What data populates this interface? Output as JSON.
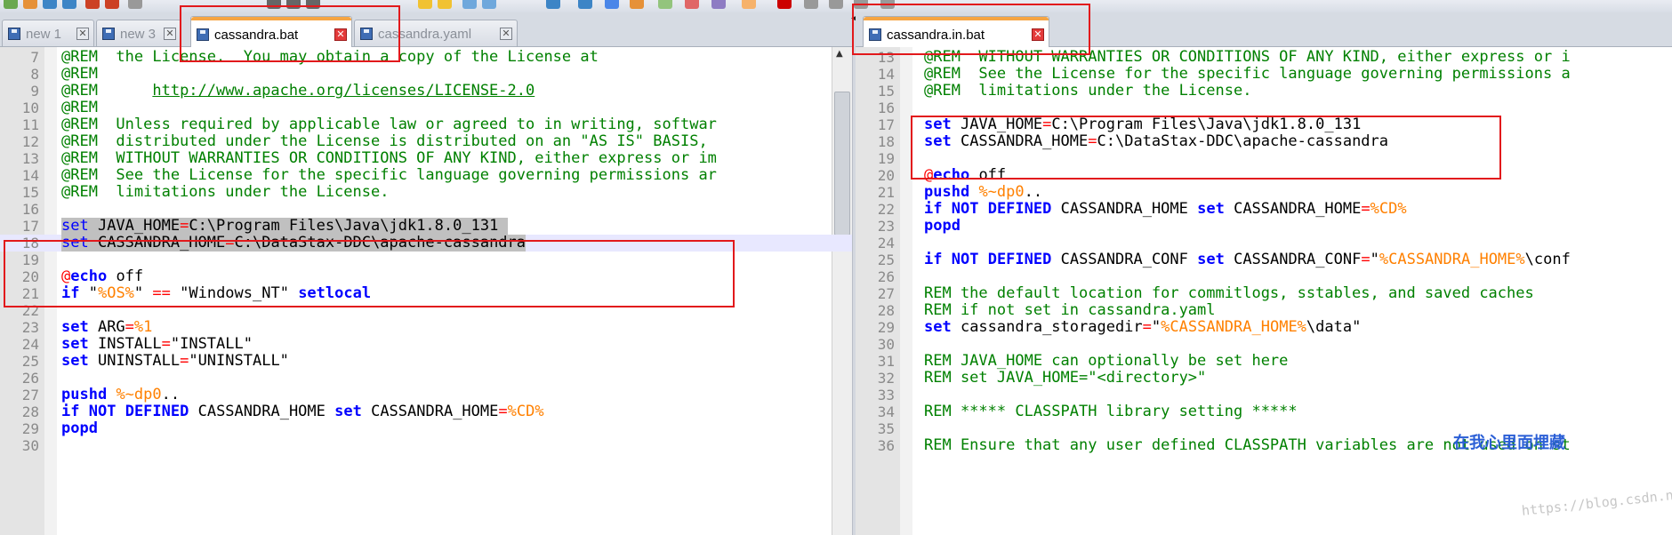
{
  "left_tabs": [
    {
      "label": "new 1",
      "active": false
    },
    {
      "label": "new 3",
      "active": false
    },
    {
      "label": "cassandra.bat",
      "active": true
    },
    {
      "label": "cassandra.yaml",
      "active": false
    }
  ],
  "right_tabs": [
    {
      "label": "cassandra.in.bat",
      "active": true
    }
  ],
  "left_lines": [
    {
      "n": "7",
      "parts": [
        [
          "rem",
          "@REM  the License.  You may obtain a copy of the License at"
        ]
      ]
    },
    {
      "n": "8",
      "parts": [
        [
          "rem",
          "@REM"
        ]
      ]
    },
    {
      "n": "9",
      "parts": [
        [
          "rem",
          "@REM      "
        ],
        [
          "link",
          "http://www.apache.org/licenses/LICENSE-2.0"
        ]
      ]
    },
    {
      "n": "10",
      "parts": [
        [
          "rem",
          "@REM"
        ]
      ]
    },
    {
      "n": "11",
      "parts": [
        [
          "rem",
          "@REM  Unless required by applicable law or agreed to in writing, softwar"
        ]
      ]
    },
    {
      "n": "12",
      "parts": [
        [
          "rem",
          "@REM  distributed under the License is distributed on an \"AS IS\" BASIS,"
        ]
      ]
    },
    {
      "n": "13",
      "parts": [
        [
          "rem",
          "@REM  WITHOUT WARRANTIES OR CONDITIONS OF ANY KIND, either express or im"
        ]
      ]
    },
    {
      "n": "14",
      "parts": [
        [
          "rem",
          "@REM  See the License for the specific language governing permissions ar"
        ]
      ]
    },
    {
      "n": "15",
      "parts": [
        [
          "rem",
          "@REM  limitations under the License."
        ]
      ]
    },
    {
      "n": "16",
      "parts": []
    },
    {
      "n": "17",
      "sel": true,
      "parts": [
        [
          "kwn",
          "set"
        ],
        [
          "txt",
          " JAVA_HOME"
        ],
        [
          "op",
          "="
        ],
        [
          "txt",
          "C:\\Program Files\\Java\\jdk1.8.0_131 "
        ]
      ]
    },
    {
      "n": "18",
      "sel": true,
      "current": true,
      "parts": [
        [
          "kwn",
          "set"
        ],
        [
          "txt",
          " CASSANDRA_HOME"
        ],
        [
          "op",
          "="
        ],
        [
          "txt",
          "C:\\DataStax-DDC\\apache-cassandra"
        ]
      ]
    },
    {
      "n": "19",
      "parts": []
    },
    {
      "n": "20",
      "parts": [
        [
          "op",
          "@"
        ],
        [
          "kw",
          "echo"
        ],
        [
          "txt",
          " off"
        ]
      ]
    },
    {
      "n": "21",
      "parts": [
        [
          "kw",
          "if"
        ],
        [
          "txt",
          " \""
        ],
        [
          "var",
          "%OS%"
        ],
        [
          "txt",
          "\" "
        ],
        [
          "op",
          "=="
        ],
        [
          "txt",
          " \"Windows_NT\" "
        ],
        [
          "kw",
          "setlocal"
        ]
      ]
    },
    {
      "n": "22",
      "parts": []
    },
    {
      "n": "23",
      "parts": [
        [
          "kw",
          "set"
        ],
        [
          "txt",
          " ARG"
        ],
        [
          "op",
          "="
        ],
        [
          "var",
          "%1"
        ]
      ]
    },
    {
      "n": "24",
      "parts": [
        [
          "kw",
          "set"
        ],
        [
          "txt",
          " INSTALL"
        ],
        [
          "op",
          "="
        ],
        [
          "txt",
          "\"INSTALL\""
        ]
      ]
    },
    {
      "n": "25",
      "parts": [
        [
          "kw",
          "set"
        ],
        [
          "txt",
          " UNINSTALL"
        ],
        [
          "op",
          "="
        ],
        [
          "txt",
          "\"UNINSTALL\""
        ]
      ]
    },
    {
      "n": "26",
      "parts": []
    },
    {
      "n": "27",
      "parts": [
        [
          "kw",
          "pushd"
        ],
        [
          "txt",
          " "
        ],
        [
          "var",
          "%~dp0"
        ],
        [
          "txt",
          ".."
        ]
      ]
    },
    {
      "n": "28",
      "parts": [
        [
          "kw",
          "if"
        ],
        [
          "txt",
          " "
        ],
        [
          "kw",
          "NOT"
        ],
        [
          "txt",
          " "
        ],
        [
          "kw",
          "DEFINED"
        ],
        [
          "txt",
          " CASSANDRA_HOME "
        ],
        [
          "kw",
          "set"
        ],
        [
          "txt",
          " CASSANDRA_HOME"
        ],
        [
          "op",
          "="
        ],
        [
          "var",
          "%CD%"
        ]
      ]
    },
    {
      "n": "29",
      "parts": [
        [
          "kw",
          "popd"
        ]
      ]
    },
    {
      "n": "30",
      "parts": []
    }
  ],
  "right_lines": [
    {
      "n": "13",
      "parts": [
        [
          "rem",
          "@REM  WITHOUT WARRANTIES OR CONDITIONS OF ANY KIND, either express or i"
        ]
      ]
    },
    {
      "n": "14",
      "parts": [
        [
          "rem",
          "@REM  See the License for the specific language governing permissions a"
        ]
      ]
    },
    {
      "n": "15",
      "parts": [
        [
          "rem",
          "@REM  limitations under the License."
        ]
      ]
    },
    {
      "n": "16",
      "parts": []
    },
    {
      "n": "17",
      "parts": [
        [
          "kw",
          "set"
        ],
        [
          "txt",
          " JAVA_HOME"
        ],
        [
          "op",
          "="
        ],
        [
          "txt",
          "C:\\Program Files\\Java\\jdk1.8.0_131"
        ]
      ]
    },
    {
      "n": "18",
      "parts": [
        [
          "kw",
          "set"
        ],
        [
          "txt",
          " CASSANDRA_HOME"
        ],
        [
          "op",
          "="
        ],
        [
          "txt",
          "C:\\DataStax-DDC\\apache-cassandra"
        ]
      ]
    },
    {
      "n": "19",
      "parts": []
    },
    {
      "n": "20",
      "parts": [
        [
          "op",
          "@"
        ],
        [
          "kw",
          "echo"
        ],
        [
          "txt",
          " off"
        ]
      ]
    },
    {
      "n": "21",
      "parts": [
        [
          "kw",
          "pushd"
        ],
        [
          "txt",
          " "
        ],
        [
          "var",
          "%~dp0"
        ],
        [
          "txt",
          ".."
        ]
      ]
    },
    {
      "n": "22",
      "parts": [
        [
          "kw",
          "if"
        ],
        [
          "txt",
          " "
        ],
        [
          "kw",
          "NOT"
        ],
        [
          "txt",
          " "
        ],
        [
          "kw",
          "DEFINED"
        ],
        [
          "txt",
          " CASSANDRA_HOME "
        ],
        [
          "kw",
          "set"
        ],
        [
          "txt",
          " CASSANDRA_HOME"
        ],
        [
          "op",
          "="
        ],
        [
          "var",
          "%CD%"
        ]
      ]
    },
    {
      "n": "23",
      "parts": [
        [
          "kw",
          "popd"
        ]
      ]
    },
    {
      "n": "24",
      "parts": []
    },
    {
      "n": "25",
      "parts": [
        [
          "kw",
          "if"
        ],
        [
          "txt",
          " "
        ],
        [
          "kw",
          "NOT"
        ],
        [
          "txt",
          " "
        ],
        [
          "kw",
          "DEFINED"
        ],
        [
          "txt",
          " CASSANDRA_CONF "
        ],
        [
          "kw",
          "set"
        ],
        [
          "txt",
          " CASSANDRA_CONF"
        ],
        [
          "op",
          "="
        ],
        [
          "txt",
          "\""
        ],
        [
          "var",
          "%CASSANDRA_HOME%"
        ],
        [
          "txt",
          "\\conf"
        ]
      ]
    },
    {
      "n": "26",
      "parts": []
    },
    {
      "n": "27",
      "parts": [
        [
          "remkw",
          "REM the default location for commitlogs, sstables, and saved caches"
        ]
      ]
    },
    {
      "n": "28",
      "parts": [
        [
          "remkw",
          "REM if not set in cassandra.yaml"
        ]
      ]
    },
    {
      "n": "29",
      "parts": [
        [
          "kw",
          "set"
        ],
        [
          "txt",
          " cassandra_storagedir"
        ],
        [
          "op",
          "="
        ],
        [
          "txt",
          "\""
        ],
        [
          "var",
          "%CASSANDRA_HOME%"
        ],
        [
          "txt",
          "\\data\""
        ]
      ]
    },
    {
      "n": "30",
      "parts": []
    },
    {
      "n": "31",
      "parts": [
        [
          "remkw",
          "REM JAVA_HOME can optionally be set here"
        ]
      ]
    },
    {
      "n": "32",
      "parts": [
        [
          "remkw",
          "REM set JAVA_HOME=\"<directory>\""
        ]
      ]
    },
    {
      "n": "33",
      "parts": []
    },
    {
      "n": "34",
      "parts": [
        [
          "remkw",
          "REM ***** CLASSPATH library setting *****"
        ]
      ]
    },
    {
      "n": "35",
      "parts": []
    },
    {
      "n": "36",
      "parts": [
        [
          "remkw",
          "REM Ensure that any user defined CLASSPATH variables are not used on st"
        ]
      ]
    }
  ],
  "watermark": {
    "cn": "在我心里面埋藏",
    "url": "https://blog.csdn.net/ZYJerer"
  },
  "colors": {
    "comment": "#008000",
    "keyword": "#0000ff",
    "operator": "#ff0000",
    "variable": "#ff8000",
    "annotation_box": "#e2191c",
    "active_tab_accent": "#f6a543"
  }
}
